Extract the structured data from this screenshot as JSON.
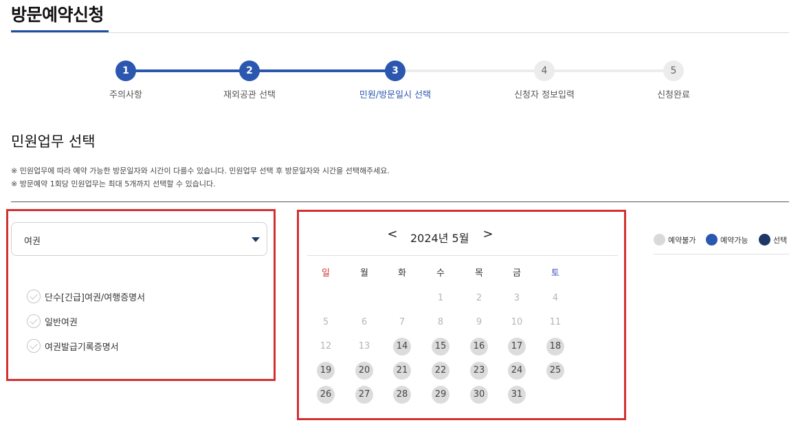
{
  "page": {
    "title": "방문예약신청"
  },
  "colors": {
    "accent": "#2b57b0",
    "highlight": "#d32f2f",
    "unavailable": "#dcdcdc",
    "available": "#2b57b0",
    "selected": "#1e3766"
  },
  "steps": [
    {
      "number": "1",
      "label": "주의사항",
      "status": "done"
    },
    {
      "number": "2",
      "label": "재외공관 선택",
      "status": "done"
    },
    {
      "number": "3",
      "label": "민원/방문일시 선택",
      "status": "current"
    },
    {
      "number": "4",
      "label": "신청자 정보입력",
      "status": "todo"
    },
    {
      "number": "5",
      "label": "신청완료",
      "status": "todo"
    }
  ],
  "section": {
    "title": "민원업무 선택",
    "notice1": "※ 민원업무에 따라 예약 가능한 방문일자와 시간이 다를수 있습니다. 민원업무 선택 후 방문일자와 시간을 선택해주세요.",
    "notice2": "※ 방문예약 1회당 민원업무는 최대 5개까지 선택할 수 있습니다."
  },
  "task_select": {
    "value": "여권",
    "icon": "caret-down-icon",
    "options": [
      "단수[긴급]여권/여행증명서",
      "일반여권",
      "여권발급기록증명서"
    ]
  },
  "calendar": {
    "title": "2024년 5월",
    "prev": "<",
    "next": ">",
    "weekdays": [
      "일",
      "월",
      "화",
      "수",
      "목",
      "금",
      "토"
    ],
    "first_weekday": 3,
    "days": [
      {
        "d": "1",
        "status": "blank"
      },
      {
        "d": "2",
        "status": "blank"
      },
      {
        "d": "3",
        "status": "blank"
      },
      {
        "d": "4",
        "status": "blank"
      },
      {
        "d": "5",
        "status": "blank"
      },
      {
        "d": "6",
        "status": "blank"
      },
      {
        "d": "7",
        "status": "blank"
      },
      {
        "d": "8",
        "status": "blank"
      },
      {
        "d": "9",
        "status": "blank"
      },
      {
        "d": "10",
        "status": "blank"
      },
      {
        "d": "11",
        "status": "blank"
      },
      {
        "d": "12",
        "status": "blank"
      },
      {
        "d": "13",
        "status": "blank"
      },
      {
        "d": "14",
        "status": "unavailable"
      },
      {
        "d": "15",
        "status": "unavailable"
      },
      {
        "d": "16",
        "status": "unavailable"
      },
      {
        "d": "17",
        "status": "unavailable"
      },
      {
        "d": "18",
        "status": "unavailable"
      },
      {
        "d": "19",
        "status": "unavailable"
      },
      {
        "d": "20",
        "status": "unavailable"
      },
      {
        "d": "21",
        "status": "unavailable"
      },
      {
        "d": "22",
        "status": "unavailable"
      },
      {
        "d": "23",
        "status": "unavailable"
      },
      {
        "d": "24",
        "status": "unavailable"
      },
      {
        "d": "25",
        "status": "unavailable"
      },
      {
        "d": "26",
        "status": "unavailable"
      },
      {
        "d": "27",
        "status": "unavailable"
      },
      {
        "d": "28",
        "status": "unavailable"
      },
      {
        "d": "29",
        "status": "unavailable"
      },
      {
        "d": "30",
        "status": "unavailable"
      },
      {
        "d": "31",
        "status": "unavailable"
      }
    ]
  },
  "legend": [
    {
      "label": "예약불가",
      "color": "#d9d9d9"
    },
    {
      "label": "예약가능",
      "color": "#2b57b0"
    },
    {
      "label": "선택",
      "color": "#1e3766"
    }
  ]
}
